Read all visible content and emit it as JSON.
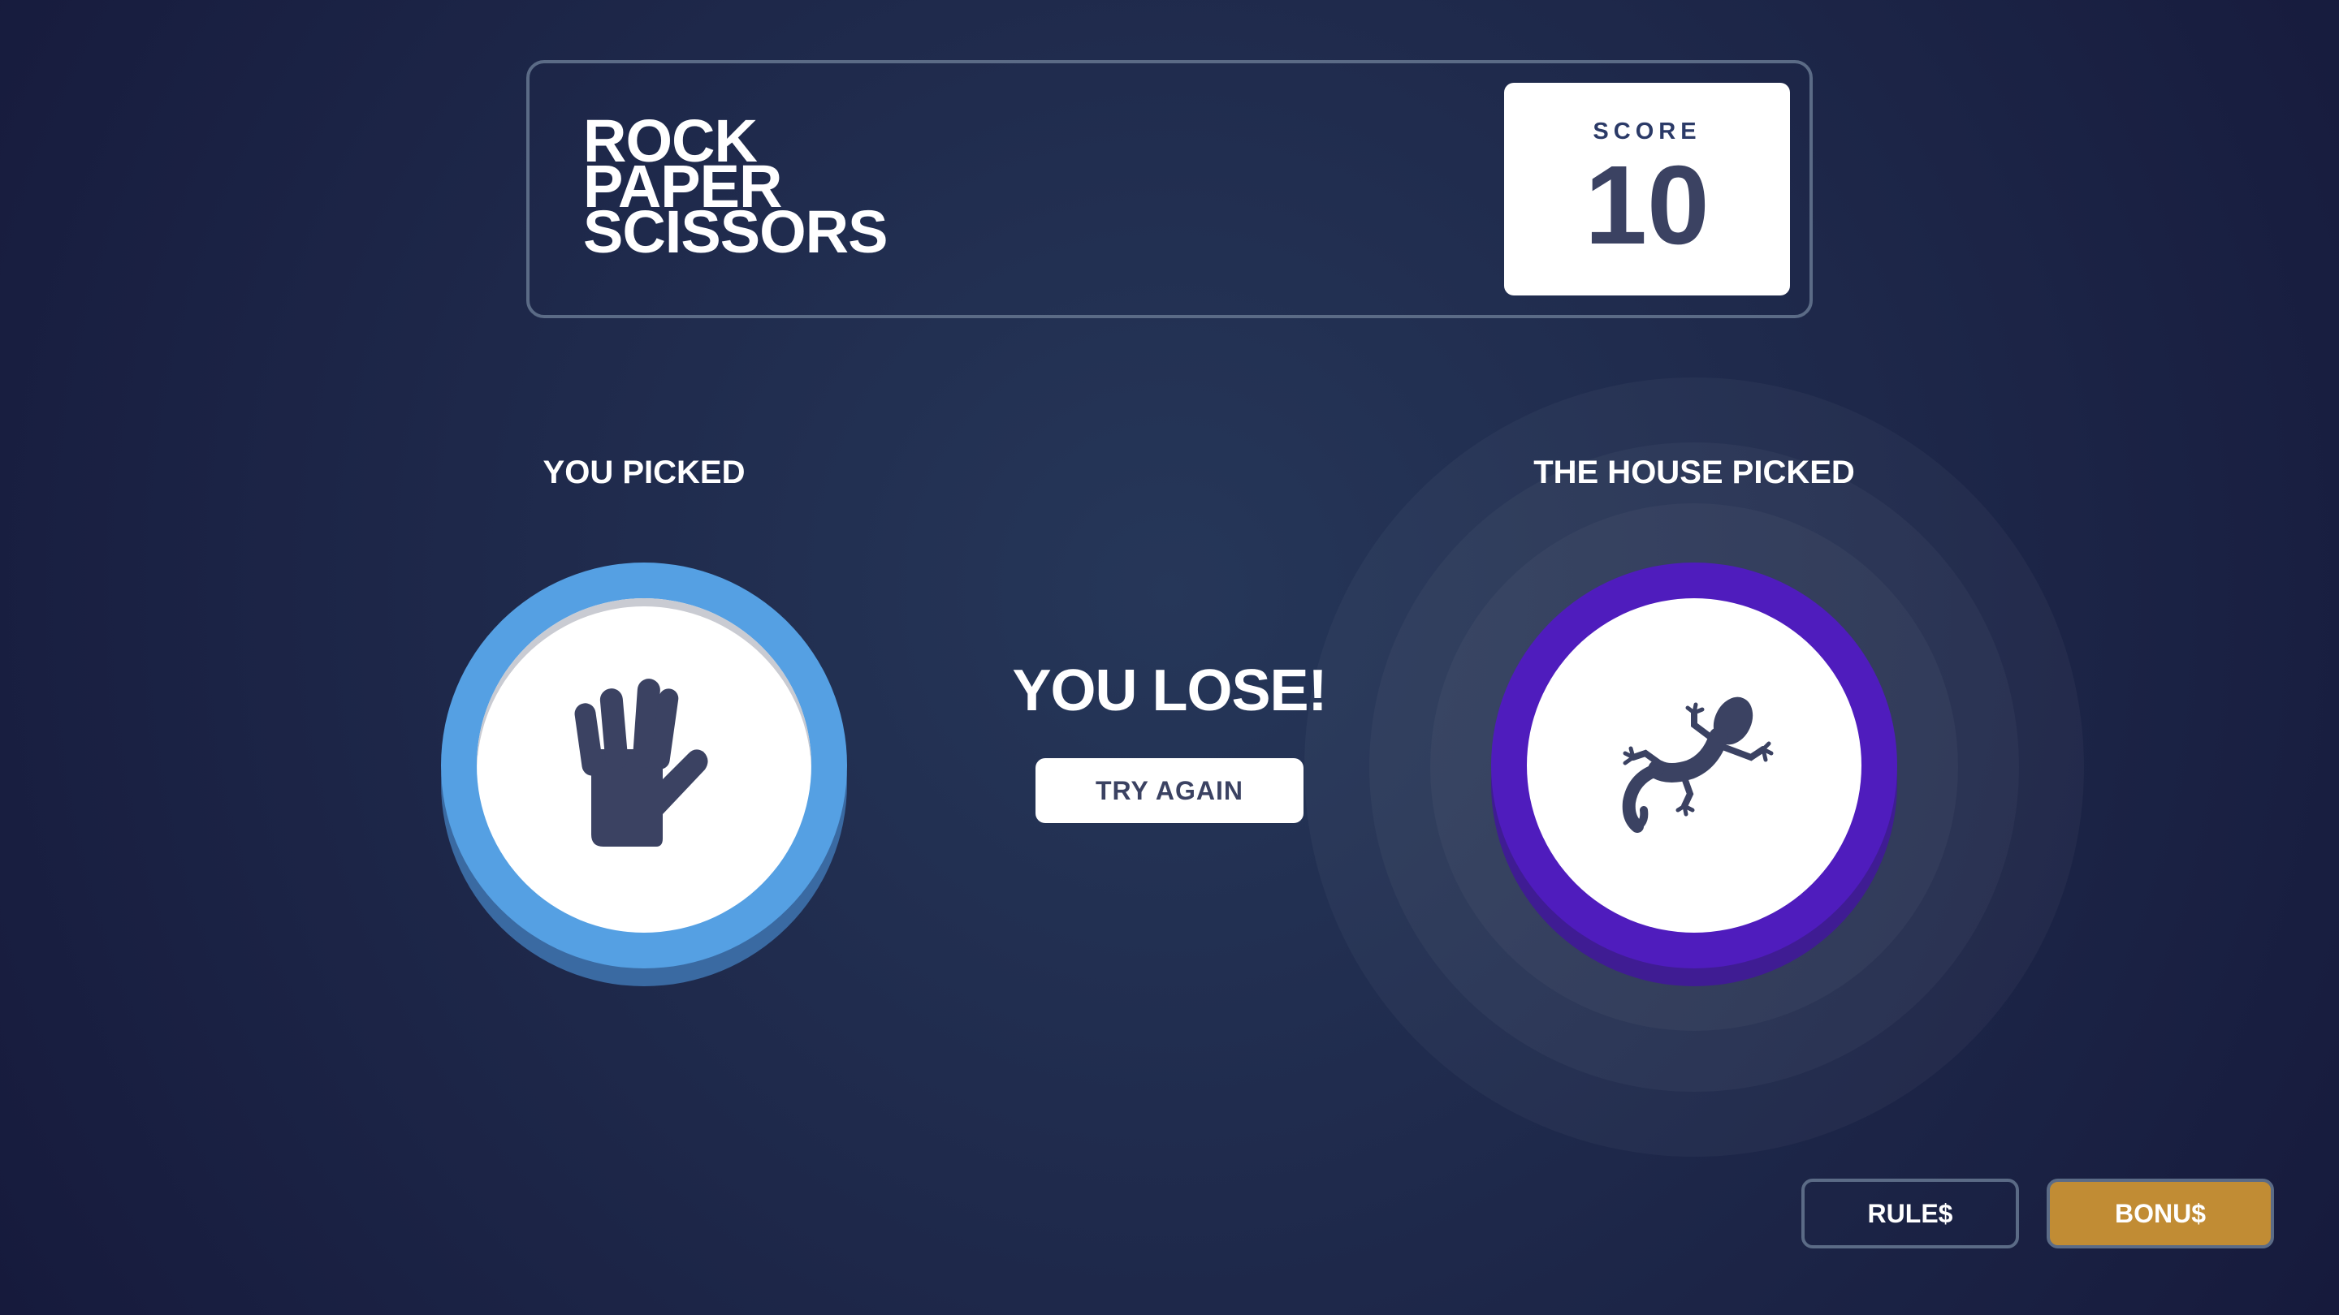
{
  "header": {
    "title_lines": [
      "ROCK",
      "PAPER",
      "SCISSORS"
    ],
    "score_label": "SCORE",
    "score_value": "10"
  },
  "game": {
    "user_label": "YOU PICKED",
    "house_label": "THE HOUSE PICKED",
    "user_pick": {
      "name": "spock",
      "icon": "spock-hand-icon",
      "color": "#55a0e3"
    },
    "house_pick": {
      "name": "lizard",
      "icon": "lizard-icon",
      "color": "#4f1cbd"
    },
    "result_text": "YOU LOSE!",
    "try_again_label": "TRY AGAIN"
  },
  "footer": {
    "rules_label": "RULE$",
    "bonus_label": "BONU$",
    "bonus_color": "#c18c34"
  },
  "colors": {
    "background": "#1f2a4c",
    "text_dark": "#3b4262",
    "border": "#5b6b86"
  }
}
